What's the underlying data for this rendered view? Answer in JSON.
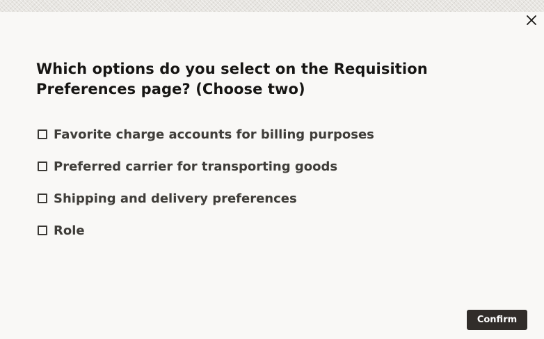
{
  "dialog": {
    "close_icon": "close-icon",
    "question": "Which options do you select on the Requisition Preferences page? (Choose two)",
    "options": [
      {
        "label": "Favorite charge accounts for billing purposes",
        "checked": false
      },
      {
        "label": "Preferred carrier for transporting goods",
        "checked": false
      },
      {
        "label": "Shipping and delivery preferences",
        "checked": false
      },
      {
        "label": "Role",
        "checked": false
      }
    ],
    "confirm_label": "Confirm"
  },
  "colors": {
    "background": "#f9f8f6",
    "text": "#161513",
    "button": "#312d2a"
  }
}
